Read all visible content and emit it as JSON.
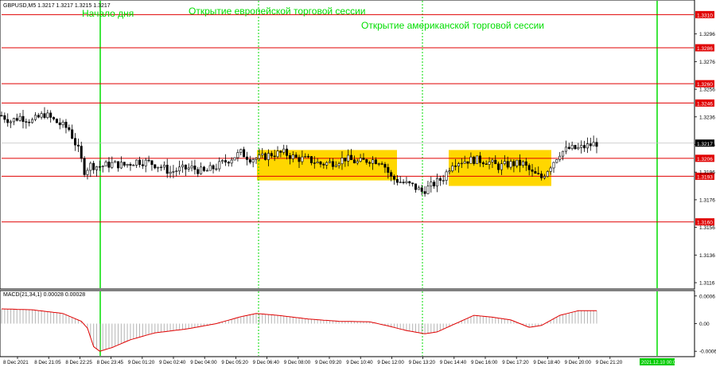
{
  "window": {
    "symbol_info": "GBPUSD,M5  1.3217 1.3217 1.3215 1.3217"
  },
  "annotations": {
    "day_start": "Начало дня",
    "eu_open": "Открытие европейской торговой сессии",
    "us_open": "Открытие американской торговой сессии"
  },
  "colors": {
    "session_line": "#00dd00",
    "level_line": "#e00000",
    "zone_fill": "#ffd700",
    "candle": "#000000",
    "macd_hist": "#b4b4b4",
    "macd_signal": "#e00000",
    "axis_text": "#000000",
    "label_bg": "#e00000",
    "label_text": "#ffffff",
    "price_label_bg": "#000000",
    "time_label_bg": "#00cc00"
  },
  "chart_data": [
    {
      "type": "candlestick",
      "ylim": [
        1.3112,
        1.332
      ],
      "y_ticks": [
        "1.3296",
        "1.3276",
        "1.3256",
        "1.3236",
        "1.3216",
        "1.3196",
        "1.3176",
        "1.3156",
        "1.3136",
        "1.3116"
      ],
      "levels": [
        "1.3310",
        "1.3286",
        "1.3260",
        "1.3246",
        "1.3206",
        "1.3193",
        "1.3160"
      ],
      "current_price": "1.3217",
      "x_labels": [
        "8 Dec 2021",
        "8 Dec 21:05",
        "8 Dec 22:25",
        "8 Dec 23:45",
        "9 Dec 01:20",
        "9 Dec 02:40",
        "9 Dec 04:00",
        "9 Dec 05:20",
        "9 Dec 06:40",
        "9 Dec 08:00",
        "9 Dec 09:20",
        "9 Dec 10:40",
        "9 Dec 12:00",
        "9 Dec 13:20",
        "9 Dec 14:40",
        "9 Dec 16:00",
        "9 Dec 17:20",
        "9 Dec 18:40",
        "9 Dec 20:00",
        "9 Dec 21:20"
      ],
      "time_label_box": "2021.12.10 00:00",
      "session_lines": [
        "day_start",
        "eu_open",
        "us_open",
        "next_day"
      ],
      "zones": [
        {
          "from": "9 Dec 06:40",
          "to": "9 Dec 12:00",
          "low": 1.319,
          "high": 1.3212
        },
        {
          "from": "9 Dec 14:40",
          "to": "9 Dec 19:00",
          "low": 1.3186,
          "high": 1.3212
        }
      ],
      "close_path": [
        [
          0,
          1.3237
        ],
        [
          3,
          1.3233
        ],
        [
          6,
          1.3236
        ],
        [
          10,
          1.3233
        ],
        [
          14,
          1.3238
        ],
        [
          18,
          1.3232
        ],
        [
          22,
          1.3227
        ],
        [
          25,
          1.3212
        ],
        [
          27,
          1.3197
        ],
        [
          29,
          1.3201
        ],
        [
          32,
          1.32
        ],
        [
          36,
          1.3202
        ],
        [
          40,
          1.3201
        ],
        [
          44,
          1.3204
        ],
        [
          48,
          1.3203
        ],
        [
          52,
          1.32
        ],
        [
          55,
          1.3196
        ],
        [
          58,
          1.3198
        ],
        [
          62,
          1.3199
        ],
        [
          66,
          1.3196
        ],
        [
          70,
          1.32
        ],
        [
          74,
          1.3205
        ],
        [
          78,
          1.321
        ],
        [
          81,
          1.3206
        ],
        [
          84,
          1.3206
        ],
        [
          88,
          1.3209
        ],
        [
          92,
          1.321
        ],
        [
          96,
          1.3206
        ],
        [
          100,
          1.3205
        ],
        [
          104,
          1.3202
        ],
        [
          108,
          1.3203
        ],
        [
          112,
          1.3206
        ],
        [
          116,
          1.3203
        ],
        [
          120,
          1.3205
        ],
        [
          124,
          1.3204
        ],
        [
          127,
          1.3192
        ],
        [
          130,
          1.3189
        ],
        [
          134,
          1.3186
        ],
        [
          137,
          1.3182
        ],
        [
          140,
          1.3186
        ],
        [
          144,
          1.3192
        ],
        [
          147,
          1.3203
        ],
        [
          150,
          1.3204
        ],
        [
          154,
          1.3205
        ],
        [
          158,
          1.3204
        ],
        [
          162,
          1.32
        ],
        [
          166,
          1.3202
        ],
        [
          170,
          1.3202
        ],
        [
          173,
          1.3195
        ],
        [
          176,
          1.3192
        ],
        [
          179,
          1.3201
        ],
        [
          182,
          1.321
        ],
        [
          185,
          1.3213
        ],
        [
          188,
          1.3213
        ],
        [
          191,
          1.3215
        ],
        [
          194,
          1.3217
        ]
      ]
    },
    {
      "type": "histogram+line",
      "label": "MACD(21,34,1) 0.00028 0.00028",
      "ylim": [
        -0.0007,
        0.0007
      ],
      "y_ticks": [
        "0.0006",
        "0.00",
        "-0.0006"
      ],
      "histogram": [
        [
          0,
          0.00032
        ],
        [
          10,
          0.0003
        ],
        [
          20,
          0.00022
        ],
        [
          26,
          5e-05
        ],
        [
          28,
          -0.0001
        ],
        [
          30,
          -0.0005
        ],
        [
          32,
          -0.0006
        ],
        [
          36,
          -0.00052
        ],
        [
          42,
          -0.00035
        ],
        [
          50,
          -0.0002
        ],
        [
          60,
          -0.00012
        ],
        [
          70,
          0.0
        ],
        [
          78,
          0.00015
        ],
        [
          83,
          0.00022
        ],
        [
          90,
          0.00018
        ],
        [
          100,
          0.0001
        ],
        [
          110,
          5e-05
        ],
        [
          120,
          4e-05
        ],
        [
          126,
          -5e-05
        ],
        [
          132,
          -0.00015
        ],
        [
          138,
          -0.00022
        ],
        [
          142,
          -0.00018
        ],
        [
          148,
          0.0
        ],
        [
          154,
          0.00018
        ],
        [
          160,
          0.00014
        ],
        [
          166,
          8e-05
        ],
        [
          172,
          -8e-05
        ],
        [
          176,
          -4e-05
        ],
        [
          182,
          0.00018
        ],
        [
          188,
          0.00028
        ],
        [
          194,
          0.00028
        ]
      ]
    }
  ]
}
